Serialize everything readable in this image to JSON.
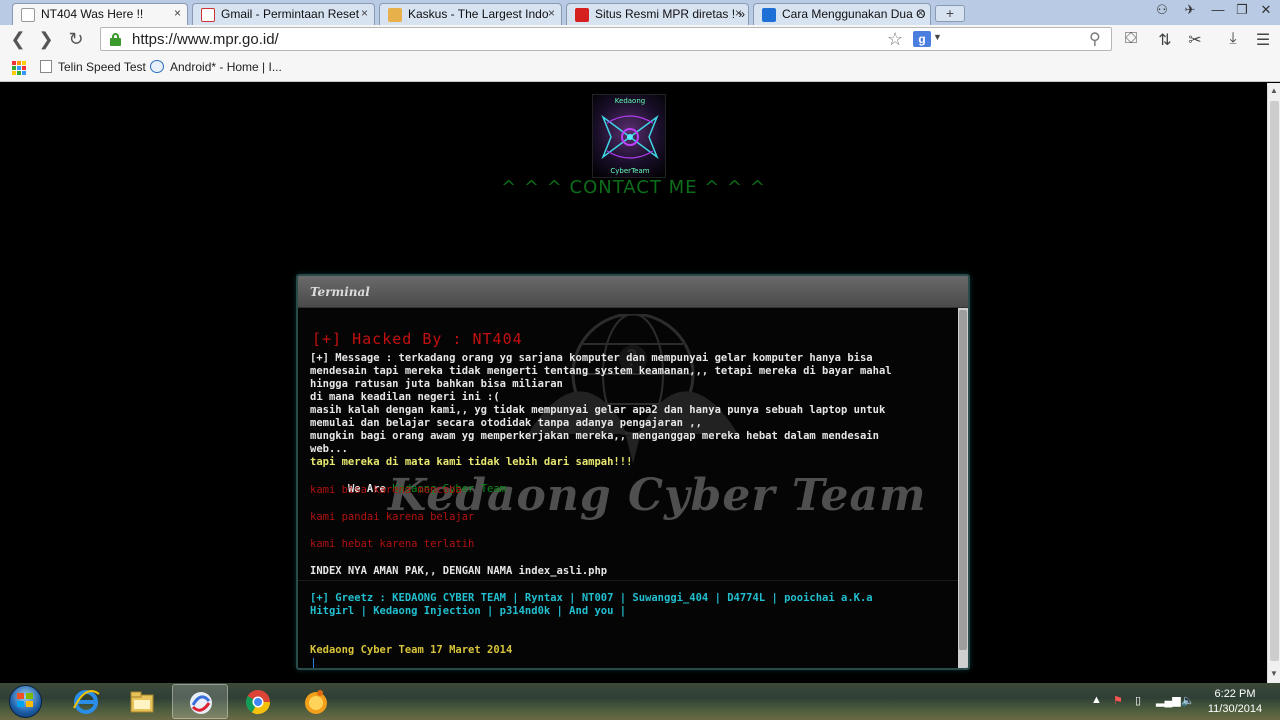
{
  "browser": {
    "tabs": [
      {
        "title": "NT404 Was Here !!",
        "active": true,
        "favicon": "page-icon"
      },
      {
        "title": "Gmail - Permintaan Reset",
        "active": false,
        "favicon": "gmail-icon"
      },
      {
        "title": "Kaskus - The Largest Indo",
        "active": false,
        "favicon": "kaskus-icon"
      },
      {
        "title": "Situs Resmi MPR diretas ! »",
        "active": false,
        "favicon": "news-icon"
      },
      {
        "title": "Cara Menggunakan Dua O",
        "active": false,
        "favicon": "windows-icon"
      }
    ],
    "tab_close_glyph": "×",
    "new_tab_glyph": "+",
    "url": "https://www.mpr.go.id/",
    "search_engine_badge": "g",
    "bookmarks": [
      {
        "label": "Telin Speed Test",
        "icon": "page-icon"
      },
      {
        "label": "Android* - Home | I...",
        "icon": "intel-icon"
      }
    ]
  },
  "page": {
    "logo_text_top": "Kedaong",
    "logo_text_bottom": "CyberTeam",
    "contact": "^ ^ ^ CONTACT ME ^ ^ ^",
    "terminal": {
      "title": "Terminal",
      "hacked_by": "[+] Hacked By : NT404",
      "message_lines": [
        "[+] Message : terkadang orang yg sarjana komputer dan mempunyai gelar komputer hanya bisa",
        "mendesain tapi mereka tidak mengerti tentang system keamanan,,, tetapi mereka di bayar mahal",
        "hingga ratusan juta bahkan bisa miliaran",
        "di mana keadilan negeri ini :(",
        "masih kalah dengan kami,, yg tidak mempunyai gelar apa2 dan hanya punya sebuah laptop untuk",
        "memulai dan belajar secara otodidak tanpa adanya pengajaran ,,",
        "mungkin bagi orang awam yg memperkerjakan mereka,, menganggap mereka hebat dalam mendesain",
        "web..."
      ],
      "highlight_line": "tapi mereka di mata kami tidak lebih dari sampah!!!",
      "we_are_prefix": "We Are",
      "team_name": "Kedaong Cyber Team",
      "motto": [
        "kami bisa karena mencoba",
        "kami pandai karena belajar",
        "kami hebat karena terlatih"
      ],
      "index_note": "INDEX NYA AMAN PAK,, DENGAN NAMA index_asli.php",
      "greetz_lines": [
        "[+] Greetz : KEDAONG CYBER TEAM | Ryntax | NT007 | Suwanggi_404 | D4774L | pooichai a.K.a",
        "Hitgirl | Kedaong Injection | p314nd0k | And you |"
      ],
      "signature": "Kedaong Cyber Team 17 Maret 2014",
      "watermark": "Kedaong Cyber Team"
    }
  },
  "taskbar": {
    "apps": [
      "internet-explorer-icon",
      "file-explorer-icon",
      "app-swirl-icon",
      "chrome-icon",
      "messenger-icon"
    ],
    "clock_time": "6:22 PM",
    "clock_date": "11/30/2014"
  },
  "colors": {
    "contact_green": "#0c6d1a",
    "hacked_red": "#c41010",
    "message_white": "#e6e6e6",
    "highlight_yellow": "#e8e870",
    "team_green": "#0c8a1a",
    "motto_red": "#b11111",
    "greetz_cyan": "#22bfd0",
    "signature_gold": "#d6c33a"
  }
}
